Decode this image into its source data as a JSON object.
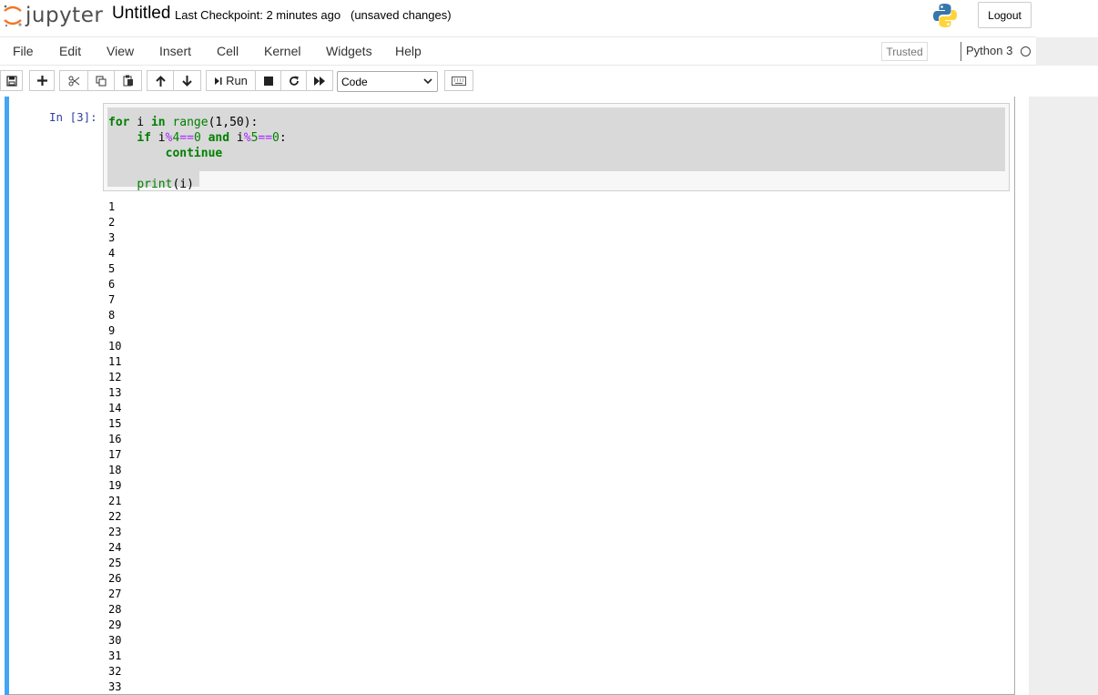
{
  "header": {
    "logo_text": "jupyter",
    "notebook_title": "Untitled",
    "checkpoint": "Last Checkpoint: 2 minutes ago",
    "unsaved": "(unsaved changes)",
    "logout_label": "Logout"
  },
  "menubar": {
    "items": [
      "File",
      "Edit",
      "View",
      "Insert",
      "Cell",
      "Kernel",
      "Widgets",
      "Help"
    ],
    "trusted_label": "Trusted",
    "kernel_name": "Python 3"
  },
  "toolbar": {
    "run_label": "Run",
    "cell_type": "Code",
    "icons": [
      "save-icon",
      "plus-icon",
      "scissors-icon",
      "copy-icon",
      "paste-icon",
      "arrow-up-icon",
      "arrow-down-icon",
      "step-forward-icon",
      "stop-icon",
      "refresh-icon",
      "fast-forward-icon",
      "keyboard-icon"
    ]
  },
  "cell": {
    "prompt": "In [3]:",
    "code_lines": [
      "for i in range(1,50):",
      "    if i%4==0 and i%5==0:",
      "        continue",
      "",
      "    print(i)"
    ],
    "output": [
      "1",
      "2",
      "3",
      "4",
      "5",
      "6",
      "7",
      "8",
      "9",
      "10",
      "11",
      "12",
      "13",
      "14",
      "15",
      "16",
      "17",
      "18",
      "19",
      "21",
      "22",
      "23",
      "24",
      "25",
      "26",
      "27",
      "28",
      "29",
      "30",
      "31",
      "32",
      "33"
    ]
  },
  "colors": {
    "cell_selected_bar": "#42a5f5",
    "prompt": "#303f9f",
    "keyword": "#008000",
    "operator": "#aa22ff",
    "jupyter_orange": "#f37726"
  }
}
